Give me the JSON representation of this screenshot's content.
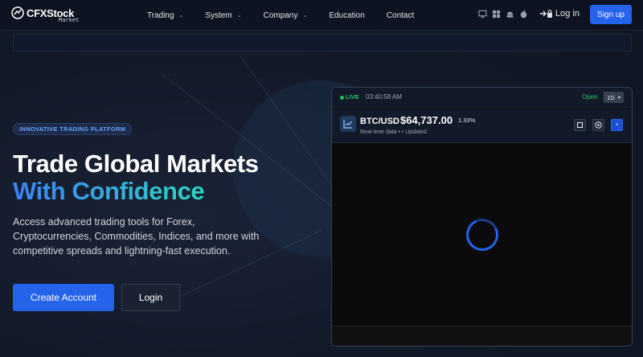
{
  "brand": {
    "name": "CFXStock",
    "sub": "Market"
  },
  "nav": {
    "items": [
      {
        "label": "Trading",
        "dropdown": true
      },
      {
        "label": "System",
        "dropdown": true
      },
      {
        "label": "Company",
        "dropdown": true
      },
      {
        "label": "Education",
        "dropdown": false
      },
      {
        "label": "Contact",
        "dropdown": false
      }
    ],
    "platform_icons": [
      "desktop-icon",
      "windows-icon",
      "android-icon",
      "apple-icon"
    ],
    "login_label": "Log in",
    "signup_label": "Sign up"
  },
  "hero": {
    "badge": "INNOVATIVE TRADING PLATFORM",
    "headline_line1": "Trade Global Markets",
    "headline_line2": "With Confidence",
    "description": "Access advanced trading tools for Forex, Cryptocurrencies, Commodities, Indices, and more with competitive spreads and lightning-fast execution.",
    "create_account_label": "Create Account",
    "login_label": "Login"
  },
  "widget": {
    "live_label": "LIVE",
    "time": "03:40:58 AM",
    "market_status": "Open",
    "timeframe": "1D",
    "pair": "BTC/USD",
    "price": "$64,737.00",
    "change": "1.33%",
    "subtitle": "Real-time data •  • Updated"
  },
  "colors": {
    "accent": "#2563eb",
    "live": "#22c55e",
    "gradient_start": "#3b82f6",
    "gradient_end": "#2dd4bf"
  }
}
